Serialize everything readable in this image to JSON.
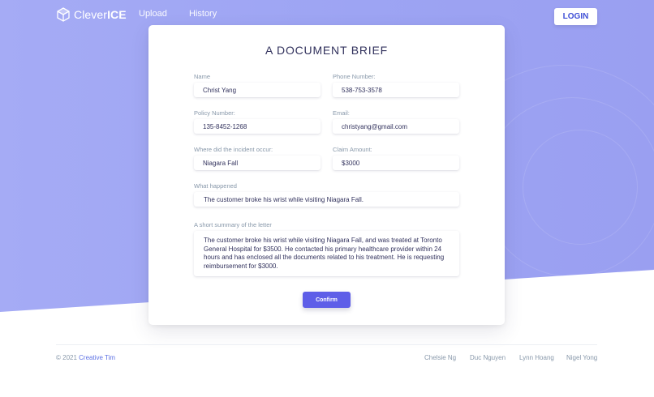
{
  "nav": {
    "brand_prefix": "Clever",
    "brand_suffix": "ICE",
    "links": [
      "Upload",
      "History"
    ],
    "login_label": "LOGIN"
  },
  "form": {
    "title": "A DOCUMENT BRIEF",
    "fields": {
      "name": {
        "label": "Name",
        "value": "Christ Yang"
      },
      "phone": {
        "label": "Phone Number:",
        "value": "538-753-3578"
      },
      "policy": {
        "label": "Policy Number:",
        "value": "135-8452-1268"
      },
      "email": {
        "label": "Email:",
        "value": "christyang@gmail.com"
      },
      "location": {
        "label": "Where did the incident occur:",
        "value": "Niagara Fall"
      },
      "amount": {
        "label": "Claim Amount:",
        "value": "$3000"
      },
      "what": {
        "label": "What happened",
        "value": "The customer broke his wrist while visiting Niagara Fall."
      },
      "summary": {
        "label": "A short summary of the letter",
        "value": "The customer broke his wrist while visiting Niagara Fall, and was treated at Toronto General Hospital for $3500. He contacted his primary healthcare provider within 24 hours and has enclosed all the documents related to his treatment. He is requesting reimbursement for $3000."
      }
    },
    "confirm_label": "Confirm"
  },
  "footer": {
    "copyright_prefix": "© 2021",
    "copyright_link": "Creative Tim",
    "links": [
      "Chelsie Ng",
      "Duc Nguyen",
      "Lynn Hoang",
      "Nigel Yong"
    ]
  },
  "colors": {
    "accent": "#5e5ee8",
    "background_gradient": "#a5abf5"
  }
}
